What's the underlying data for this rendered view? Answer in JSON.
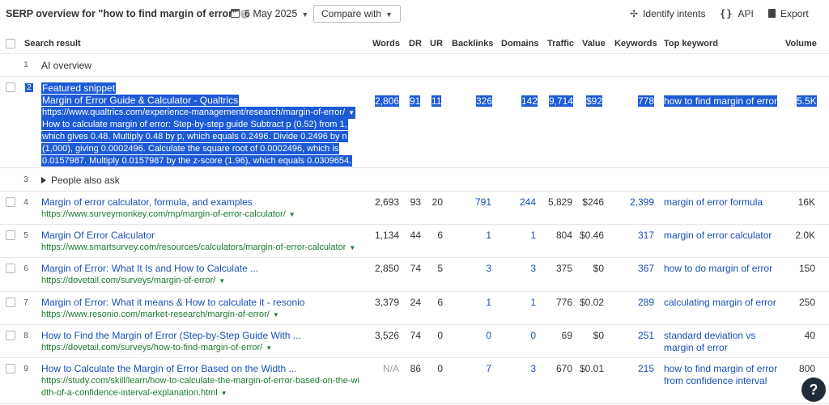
{
  "header": {
    "title": "SERP overview for \"how to find margin of error\"",
    "date": "6 May 2025",
    "compare_label": "Compare with",
    "identify_intents": "Identify intents",
    "api": "API",
    "export": "Export",
    "icons": [
      "help-icon",
      "calendar-icon",
      "chevron-down-icon",
      "sparkle-icon",
      "code-braces-icon",
      "export-icon"
    ]
  },
  "columns": [
    "Search result",
    "Words",
    "DR",
    "UR",
    "Backlinks",
    "Domains",
    "Traffic",
    "Value",
    "Keywords",
    "Top keyword",
    "Volume"
  ],
  "ai_overview": {
    "num": "1",
    "label": "AI overview"
  },
  "featured": {
    "num": "2",
    "label": "Featured snippet",
    "title": "Margin of Error Guide & Calculator - Qualtrics",
    "url": "https://www.qualtrics.com/experience-management/research/margin-of-error/",
    "snippet": [
      "How to calculate margin of error: Step-by-step guide Subtract p (0.52) from 1,",
      "which gives 0.48. Multiply 0.48 by p, which equals 0.2496. Divide 0.2496 by n",
      "(1,000), giving 0.0002496. Calculate the square root of 0.0002496, which is",
      "0.0157987. Multiply 0.0157987 by the z-score (1.96), which equals 0.0309654."
    ],
    "words": "2,806",
    "dr": "91",
    "ur": "11",
    "backlinks": "326",
    "domains": "142",
    "traffic": "9,714",
    "value": "$92",
    "keywords": "778",
    "top_keyword": "how to find margin of error",
    "volume": "5.5K"
  },
  "paa": {
    "num": "3",
    "label": "People also ask"
  },
  "rows": [
    {
      "num": "4",
      "title": "Margin of error calculator, formula, and examples",
      "url": "https://www.surveymonkey.com/mp/margin-of-error-calculator/",
      "url2": "",
      "words": "2,693",
      "dr": "93",
      "ur": "20",
      "backlinks": "791",
      "domains": "244",
      "traffic": "5,829",
      "value": "$246",
      "keywords": "2,399",
      "kw1": "margin of error formula",
      "kw2": "",
      "volume": "16K"
    },
    {
      "num": "5",
      "title": "Margin Of Error Calculator",
      "url": "https://www.smartsurvey.com/resources/calculators/margin-of-error-calculator",
      "url2": "",
      "words": "1,134",
      "dr": "44",
      "ur": "6",
      "backlinks": "1",
      "domains": "1",
      "traffic": "804",
      "value": "$0.46",
      "keywords": "317",
      "kw1": "margin of error calculator",
      "kw2": "",
      "volume": "2.0K"
    },
    {
      "num": "6",
      "title": "Margin of Error: What It Is and How to Calculate ...",
      "url": "https://dovetail.com/surveys/margin-of-error/",
      "url2": "",
      "words": "2,850",
      "dr": "74",
      "ur": "5",
      "backlinks": "3",
      "domains": "3",
      "traffic": "375",
      "value": "$0",
      "keywords": "367",
      "kw1": "how to do margin of error",
      "kw2": "",
      "volume": "150"
    },
    {
      "num": "7",
      "title": "Margin of Error: What it means & How to calculate it - resonio",
      "url": "https://www.resonio.com/market-research/margin-of-error/",
      "url2": "",
      "words": "3,379",
      "dr": "24",
      "ur": "6",
      "backlinks": "1",
      "domains": "1",
      "traffic": "776",
      "value": "$0.02",
      "keywords": "289",
      "kw1": "calculating margin of error",
      "kw2": "",
      "volume": "250"
    },
    {
      "num": "8",
      "title": "How to Find the Margin of Error (Step-by-Step Guide With ...",
      "url": "https://dovetail.com/surveys/how-to-find-margin-of-error/",
      "url2": "",
      "words": "3,526",
      "dr": "74",
      "ur": "0",
      "backlinks": "0",
      "domains": "0",
      "traffic": "69",
      "value": "$0",
      "keywords": "251",
      "kw1": "standard deviation vs",
      "kw2": "margin of error",
      "volume": "40"
    },
    {
      "num": "9",
      "title": "How to Calculate the Margin of Error Based on the Width ...",
      "url": "https://study.com/skill/learn/how-to-calculate-the-margin-of-error-based-on-the-wi",
      "url2": "dth-of-a-confidence-interval-explanation.html",
      "words": "N/A",
      "dr": "86",
      "ur": "0",
      "backlinks": "7",
      "domains": "3",
      "traffic": "670",
      "value": "$0.01",
      "keywords": "215",
      "kw1": "how to find margin of error",
      "kw2": "from confidence interval",
      "volume": "800"
    }
  ],
  "help_button": "?"
}
